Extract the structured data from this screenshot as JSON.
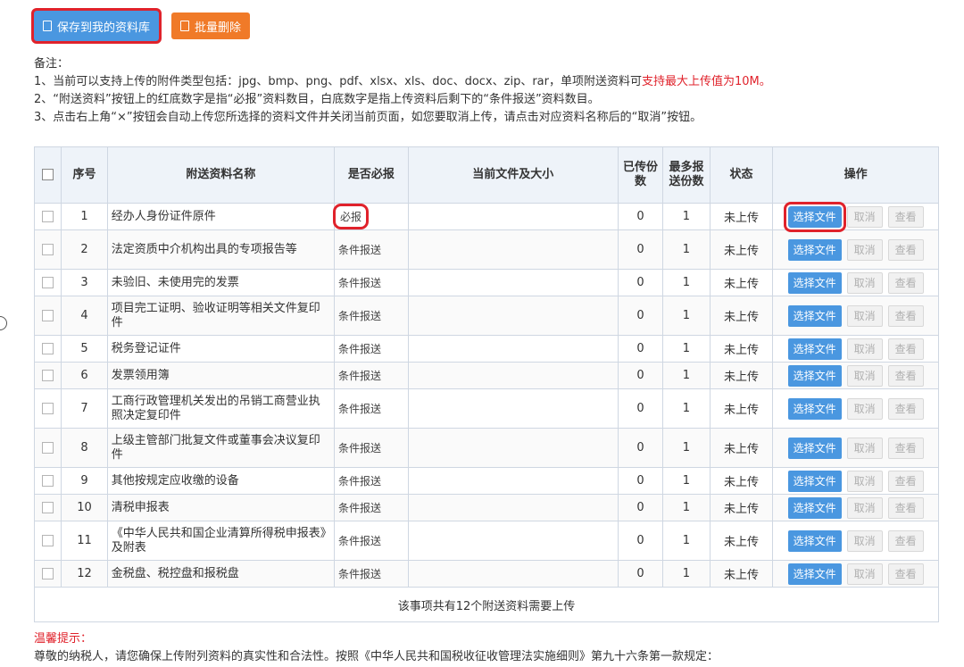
{
  "toolbar": {
    "save_label": "保存到我的资料库",
    "delete_label": "批量删除"
  },
  "notes": {
    "title": "备注：",
    "line1_prefix": "1、当前可以支持上传的附件类型包括：jpg、bmp、png、pdf、xlsx、xls、doc、docx、zip、rar，单项附送资料可",
    "line1_red": "支持最大上传值为10M。",
    "line2": "2、“附送资料”按钮上的红底数字是指“必报”资料数目，白底数字是指上传资料后剩下的“条件报送”资料数目。",
    "line3": "3、点击右上角“×”按钮会自动上传您所选择的资料文件并关闭当前页面，如您要取消上传，请点击对应资料名称后的“取消”按钮。"
  },
  "table": {
    "headers": {
      "seq": "序号",
      "name": "附送资料名称",
      "required": "是否必报",
      "current_file": "当前文件及大小",
      "uploaded": "已传份数",
      "max": "最多报送份数",
      "status": "状态",
      "actions": "操作"
    },
    "rows": [
      {
        "seq": "1",
        "name": "经办人身份证件原件",
        "required": "必报",
        "uploaded": "0",
        "max": "1",
        "status": "未上传",
        "choose": "选择文件",
        "cancel": "取消",
        "view": "查看"
      },
      {
        "seq": "2",
        "name": "法定资质中介机构出具的专项报告等",
        "required": "条件报送",
        "uploaded": "0",
        "max": "1",
        "status": "未上传",
        "choose": "选择文件",
        "cancel": "取消",
        "view": "查看"
      },
      {
        "seq": "3",
        "name": "未验旧、未使用完的发票",
        "required": "条件报送",
        "uploaded": "0",
        "max": "1",
        "status": "未上传",
        "choose": "选择文件",
        "cancel": "取消",
        "view": "查看"
      },
      {
        "seq": "4",
        "name": "项目完工证明、验收证明等相关文件复印件",
        "required": "条件报送",
        "uploaded": "0",
        "max": "1",
        "status": "未上传",
        "choose": "选择文件",
        "cancel": "取消",
        "view": "查看"
      },
      {
        "seq": "5",
        "name": "税务登记证件",
        "required": "条件报送",
        "uploaded": "0",
        "max": "1",
        "status": "未上传",
        "choose": "选择文件",
        "cancel": "取消",
        "view": "查看"
      },
      {
        "seq": "6",
        "name": "发票领用簿",
        "required": "条件报送",
        "uploaded": "0",
        "max": "1",
        "status": "未上传",
        "choose": "选择文件",
        "cancel": "取消",
        "view": "查看"
      },
      {
        "seq": "7",
        "name": "工商行政管理机关发出的吊销工商营业执照决定复印件",
        "required": "条件报送",
        "uploaded": "0",
        "max": "1",
        "status": "未上传",
        "choose": "选择文件",
        "cancel": "取消",
        "view": "查看"
      },
      {
        "seq": "8",
        "name": "上级主管部门批复文件或董事会决议复印件",
        "required": "条件报送",
        "uploaded": "0",
        "max": "1",
        "status": "未上传",
        "choose": "选择文件",
        "cancel": "取消",
        "view": "查看"
      },
      {
        "seq": "9",
        "name": "其他按规定应收缴的设备",
        "required": "条件报送",
        "uploaded": "0",
        "max": "1",
        "status": "未上传",
        "choose": "选择文件",
        "cancel": "取消",
        "view": "查看"
      },
      {
        "seq": "10",
        "name": "清税申报表",
        "required": "条件报送",
        "uploaded": "0",
        "max": "1",
        "status": "未上传",
        "choose": "选择文件",
        "cancel": "取消",
        "view": "查看"
      },
      {
        "seq": "11",
        "name": "《中华人民共和国企业清算所得税申报表》及附表",
        "required": "条件报送",
        "uploaded": "0",
        "max": "1",
        "status": "未上传",
        "choose": "选择文件",
        "cancel": "取消",
        "view": "查看"
      },
      {
        "seq": "12",
        "name": "金税盘、税控盘和报税盘",
        "required": "条件报送",
        "uploaded": "0",
        "max": "1",
        "status": "未上传",
        "choose": "选择文件",
        "cancel": "取消",
        "view": "查看"
      }
    ],
    "footer": "该事项共有12个附送资料需要上传"
  },
  "tip": {
    "title": "温馨提示：",
    "text": "尊敬的纳税人，请您确保上传附列资料的真实性和合法性。按照《中华人民共和国税收征收管理法实施细则》第九十六条第一款规定："
  },
  "colors": {
    "primary_blue": "#4a97e0",
    "orange": "#f07a28",
    "highlight_red": "#e0222b"
  }
}
